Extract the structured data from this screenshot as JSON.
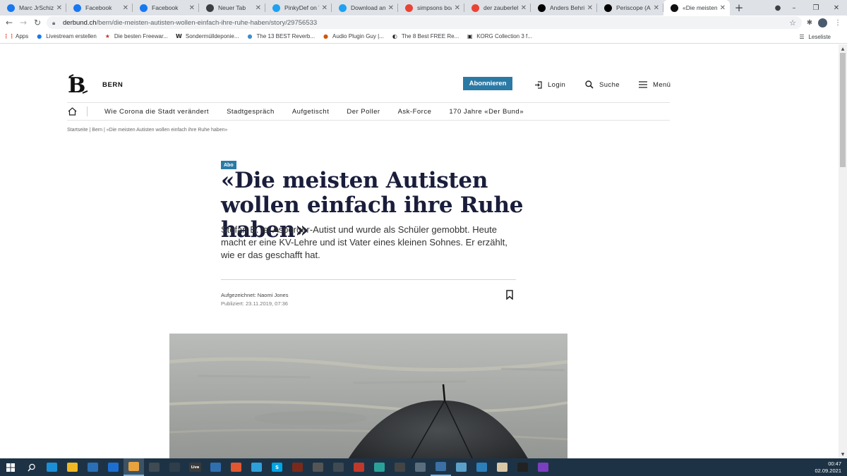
{
  "browser": {
    "tabs": [
      {
        "title": "Marc JrSchizo Lu",
        "favicon": "facebook-icon",
        "color": "#1877f2"
      },
      {
        "title": "Facebook",
        "favicon": "facebook-icon",
        "color": "#1877f2"
      },
      {
        "title": "Facebook",
        "favicon": "facebook-icon",
        "color": "#1877f2"
      },
      {
        "title": "Neuer Tab",
        "favicon": "chrome-icon",
        "color": "#3c4043"
      },
      {
        "title": "PinkyDef on Twi",
        "favicon": "twitter-icon",
        "color": "#1da1f2"
      },
      {
        "title": "Download an ar",
        "favicon": "twitter-icon",
        "color": "#1da1f2"
      },
      {
        "title": "simpsons boat g",
        "favicon": "google-icon",
        "color": "#ea4335"
      },
      {
        "title": "der zauberlehrli",
        "favicon": "google-icon",
        "color": "#ea4335"
      },
      {
        "title": "Anders Behring",
        "favicon": "wikipedia-icon",
        "color": "#000000"
      },
      {
        "title": "Periscope (App)",
        "favicon": "wikipedia-icon",
        "color": "#000000"
      },
      {
        "title": "«Die meisten Au",
        "favicon": "derbund-icon",
        "color": "#111111",
        "active": true
      }
    ],
    "new_tab_label": "+",
    "url_host": "derbund.ch",
    "url_path": "/bern/die-meisten-autisten-wollen-einfach-ihre-ruhe-haben/story/29756533",
    "bookmarks_label": "Apps",
    "bookmarks": [
      {
        "label": "Livestream erstellen",
        "icon": "facebook-icon",
        "color": "#1877f2"
      },
      {
        "label": "Die besten Freewar...",
        "icon": "star-icon",
        "color": "#c0392b"
      },
      {
        "label": "Sondermülldeponie...",
        "icon": "w-icon",
        "color": "#222222"
      },
      {
        "label": "The 13 BEST Reverb...",
        "icon": "plugin-icon",
        "color": "#3b8ed0"
      },
      {
        "label": "Audio Plugin Guy |...",
        "icon": "apg-icon",
        "color": "#d35400"
      },
      {
        "label": "The 8 Best FREE Re...",
        "icon": "moon-icon",
        "color": "#222222"
      },
      {
        "label": "KORG Collection 3 f...",
        "icon": "korg-icon",
        "color": "#222222"
      }
    ],
    "reading_list": "Leseliste"
  },
  "site": {
    "edition": "BERN",
    "subscribe": "Abonnieren",
    "login": "Login",
    "search": "Suche",
    "menu": "Menü",
    "nav": [
      "Wie Corona die Stadt verändert",
      "Stadtgespräch",
      "Aufgetischt",
      "Der Poller",
      "Ask-Force",
      "170 Jahre «Der Bund»"
    ],
    "breadcrumb": "Startseite | Bern | «Die meisten Autisten wollen einfach ihre Ruhe haben»"
  },
  "article": {
    "badge": "Abo",
    "headline": "«Die meisten Autisten wollen einfach ihre Ruhe haben»",
    "lead": "Stefan B. ist Asperger-Autist und wurde als Schüler gemobbt. Heute macht er eine KV-Lehre und ist Vater eines kleinen Sohnes. Er erzählt, wie er das geschafft hat.",
    "author": "Aufgezeichnet: Naomi Jones",
    "published": "Publiziert: 23.11.2019, 07:36"
  },
  "taskbar": {
    "time": "00:47",
    "date": "02.09.2021",
    "apps": [
      {
        "name": "edge-icon",
        "color": "#1a8fd6",
        "label": ""
      },
      {
        "name": "file-explorer-icon",
        "color": "#f2b824",
        "label": ""
      },
      {
        "name": "store-icon",
        "color": "#2a6fb5",
        "label": ""
      },
      {
        "name": "mail-icon",
        "color": "#1c6fd1",
        "label": ""
      },
      {
        "name": "chrome-icon",
        "color": "#e8a33d",
        "label": "",
        "state": "active"
      },
      {
        "name": "tool-icon",
        "color": "#3f4a52",
        "label": ""
      },
      {
        "name": "app-icon",
        "color": "#2f3e4a",
        "label": ""
      },
      {
        "name": "live-icon",
        "color": "#3a3a3a",
        "label": "Live"
      },
      {
        "name": "app-icon",
        "color": "#2f6fb0",
        "label": ""
      },
      {
        "name": "app-icon",
        "color": "#e2572f",
        "label": ""
      },
      {
        "name": "telegram-icon",
        "color": "#2ea0d9",
        "label": ""
      },
      {
        "name": "skype-icon",
        "color": "#00a4e4",
        "label": "S"
      },
      {
        "name": "app-icon",
        "color": "#7a2a1a",
        "label": ""
      },
      {
        "name": "app-icon",
        "color": "#555555",
        "label": ""
      },
      {
        "name": "tool-icon",
        "color": "#3f4a52",
        "label": ""
      },
      {
        "name": "app-icon",
        "color": "#c0392b",
        "label": ""
      },
      {
        "name": "app-icon",
        "color": "#2aa198",
        "label": ""
      },
      {
        "name": "app-icon",
        "color": "#444444",
        "label": ""
      },
      {
        "name": "cube-icon",
        "color": "#5a6d7c",
        "label": ""
      },
      {
        "name": "app-icon",
        "color": "#3c6fa3",
        "label": "",
        "state": "running"
      },
      {
        "name": "app-icon",
        "color": "#5aa0c8",
        "label": ""
      },
      {
        "name": "app-icon",
        "color": "#2c7fb8",
        "label": ""
      },
      {
        "name": "app-icon",
        "color": "#d9c7a5",
        "label": ""
      },
      {
        "name": "terminal-icon",
        "color": "#222222",
        "label": ""
      },
      {
        "name": "app-icon",
        "color": "#7a3fbf",
        "label": ""
      }
    ]
  },
  "colors": {
    "accent": "#2b7aa6",
    "headline": "#1a1e3b",
    "taskbar": "#1d3345"
  }
}
